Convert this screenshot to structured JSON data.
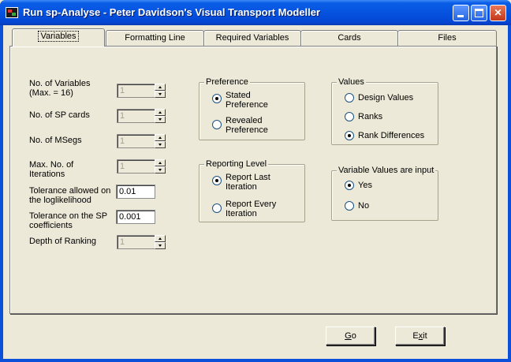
{
  "window": {
    "title": "Run sp-Analyse - Peter Davidson's Visual Transport Modeller",
    "buttons": {
      "minimize": "_",
      "maximize": "□",
      "close": "✕"
    }
  },
  "tabs": [
    {
      "label": "Variables",
      "active": true
    },
    {
      "label": "Formatting Line",
      "active": false
    },
    {
      "label": "Required Variables",
      "active": false
    },
    {
      "label": "Cards",
      "active": false
    },
    {
      "label": "Files",
      "active": false
    }
  ],
  "fields": {
    "num_variables": {
      "label_line1": "No. of Variables",
      "label_line2": "(Max. = 16)",
      "value": "1"
    },
    "num_sp_cards": {
      "label": "No. of SP cards",
      "value": "1"
    },
    "num_msegs": {
      "label": "No. of MSegs",
      "value": "1"
    },
    "max_iterations": {
      "label_line1": "Max. No. of",
      "label_line2": "Iterations",
      "value": "1"
    },
    "tolerance_loglik": {
      "label_line1": "Tolerance allowed on",
      "label_line2": "the loglikelihood",
      "value": "0.01"
    },
    "tolerance_sp": {
      "label_line1": "Tolerance on the SP",
      "label_line2": "coefficients",
      "value": "0.001"
    },
    "depth_ranking": {
      "label": "Depth of Ranking",
      "value": "1"
    }
  },
  "preference": {
    "title": "Preference",
    "options": [
      {
        "line1": "Stated",
        "line2": "Preference",
        "checked": true
      },
      {
        "line1": "Revealed",
        "line2": "Preference",
        "checked": false
      }
    ]
  },
  "reporting_level": {
    "title": "Reporting Level",
    "options": [
      {
        "line1": "Report Last",
        "line2": "Iteration",
        "checked": true
      },
      {
        "line1": "Report Every",
        "line2": "Iteration",
        "checked": false
      }
    ]
  },
  "values": {
    "title": "Values",
    "options": [
      {
        "label": "Design Values",
        "checked": false
      },
      {
        "label": "Ranks",
        "checked": false
      },
      {
        "label": "Rank Differences",
        "checked": true
      }
    ]
  },
  "variable_values_input": {
    "title": "Variable Values are input",
    "options": [
      {
        "label": "Yes",
        "checked": true
      },
      {
        "label": "No",
        "checked": false
      }
    ]
  },
  "buttons": {
    "go": {
      "mnemonic": "G",
      "rest": "o"
    },
    "exit": {
      "pre": "E",
      "mnemonic": "x",
      "rest": "it"
    }
  }
}
